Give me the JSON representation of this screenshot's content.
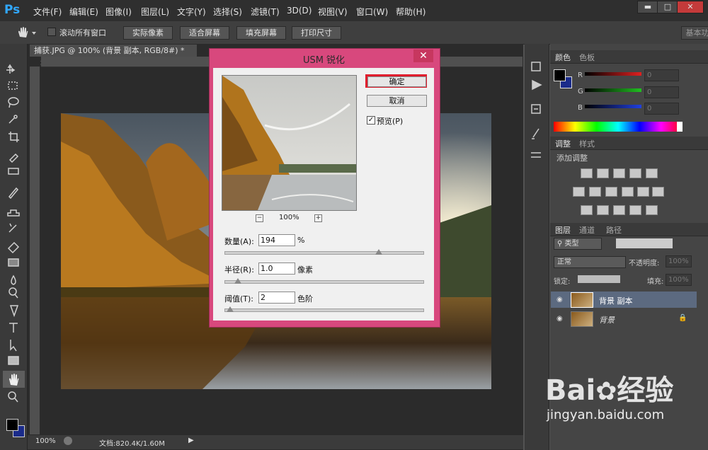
{
  "app": {
    "logo": "Ps"
  },
  "menu": [
    "文件(F)",
    "编辑(E)",
    "图像(I)",
    "图层(L)",
    "文字(Y)",
    "选择(S)",
    "滤镜(T)",
    "3D(D)",
    "视图(V)",
    "窗口(W)",
    "帮助(H)"
  ],
  "window_controls": {
    "minimize": "▬",
    "maximize": "□",
    "close": "✕"
  },
  "options": {
    "scroll_all_label": "滚动所有窗口",
    "actual_pixels": "实际像素",
    "fit_screen": "适合屏幕",
    "fill_screen": "填充屏幕",
    "print_size": "打印尺寸",
    "workspace": "基本功"
  },
  "document": {
    "tab_title": "捕获.JPG @ 100% (背景 副本, RGB/8#) *",
    "tab_close": "×",
    "zoom": "100%",
    "doc_info": "文档:820.4K/1.60M"
  },
  "dialog": {
    "title": "USM 锐化",
    "close": "✕",
    "ok": "确定",
    "cancel": "取消",
    "preview_label": "预览(P)",
    "preview_checked": true,
    "zoom_out": "−",
    "zoom_in": "+",
    "zoom": "100%",
    "amount_label": "数量(A):",
    "amount_value": "194",
    "amount_unit": "%",
    "amount_fraction": 0.76,
    "radius_label": "半径(R):",
    "radius_value": "1.0",
    "radius_unit": "像素",
    "radius_fraction": 0.05,
    "threshold_label": "阈值(T):",
    "threshold_value": "2",
    "threshold_unit": "色阶",
    "threshold_fraction": 0.01,
    "highlight_color": "#e01e2e"
  },
  "color_panel": {
    "tabs": [
      "颜色",
      "色板"
    ],
    "channels": [
      {
        "label": "R",
        "value": "0",
        "color": "#e02020"
      },
      {
        "label": "G",
        "value": "0",
        "color": "#20c020"
      },
      {
        "label": "B",
        "value": "0",
        "color": "#2040e0"
      }
    ],
    "foreground": "#000000",
    "background": "#1a2b8a"
  },
  "adjust_panel": {
    "tabs": [
      "调整",
      "样式"
    ],
    "add_label": "添加调整"
  },
  "layers_panel": {
    "tabs": [
      "图层",
      "通道",
      "路径"
    ],
    "filter_label": "类型",
    "blend_mode": "正常",
    "opacity_label": "不透明度:",
    "opacity_value": "100%",
    "lock_label": "锁定:",
    "fill_label": "填充:",
    "fill_value": "100%",
    "layers": [
      {
        "name": "背景 副本",
        "selected": true,
        "locked": false
      },
      {
        "name": "背景",
        "selected": false,
        "locked": true
      }
    ]
  },
  "watermark": {
    "brand": "Bai",
    "brand2": "经验",
    "url": "jingyan.baidu.com"
  }
}
